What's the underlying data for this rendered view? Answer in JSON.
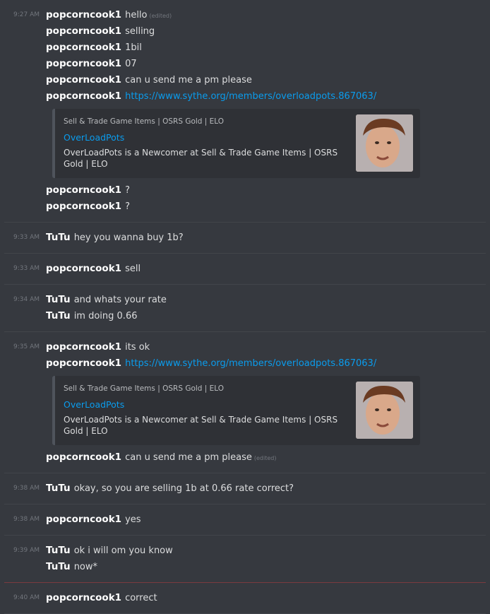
{
  "messages": {
    "g1": {
      "time": "9:27 AM",
      "lines": [
        {
          "author": "popcorncook1",
          "text": "hello",
          "edited": "(edited)"
        },
        {
          "author": "popcorncook1",
          "text": "selling"
        },
        {
          "author": "popcorncook1",
          "text": "1bil"
        },
        {
          "author": "popcorncook1",
          "text": "07"
        },
        {
          "author": "popcorncook1",
          "text": "can u send me a pm please"
        },
        {
          "author": "popcorncook1",
          "link": "https://www.sythe.org/members/overloadpots.867063/"
        }
      ],
      "embed": {
        "provider": "Sell & Trade Game Items | OSRS Gold | ELO",
        "title": "OverLoadPots",
        "description": "OverLoadPots is a Newcomer at Sell & Trade Game Items | OSRS Gold | ELO"
      },
      "after": [
        {
          "author": "popcorncook1",
          "text": "?"
        },
        {
          "author": "popcorncook1",
          "text": "?"
        }
      ]
    },
    "g2": {
      "time": "9:33 AM",
      "author": "TuTu",
      "text": "hey you wanna buy 1b?"
    },
    "g3": {
      "time": "9:33 AM",
      "author": "popcorncook1",
      "text": "sell"
    },
    "g4": {
      "time": "9:34 AM",
      "lines": [
        {
          "author": "TuTu",
          "text": "and whats your rate"
        },
        {
          "author": "TuTu",
          "text": "im doing 0.66"
        }
      ]
    },
    "g5": {
      "time": "9:35 AM",
      "lines": [
        {
          "author": "popcorncook1",
          "text": "its ok"
        },
        {
          "author": "popcorncook1",
          "link": "https://www.sythe.org/members/overloadpots.867063/"
        }
      ],
      "embed": {
        "provider": "Sell & Trade Game Items | OSRS Gold | ELO",
        "title": "OverLoadPots",
        "description": "OverLoadPots is a Newcomer at Sell & Trade Game Items | OSRS Gold | ELO"
      },
      "after": [
        {
          "author": "popcorncook1",
          "text": "can u send me a pm please",
          "edited": "(edited)"
        }
      ]
    },
    "g6": {
      "time": "9:38 AM",
      "author": "TuTu",
      "text": "okay, so you are selling 1b at 0.66 rate correct?"
    },
    "g7": {
      "time": "9:38 AM",
      "author": "popcorncook1",
      "text": "yes"
    },
    "g8": {
      "time": "9:39 AM",
      "lines": [
        {
          "author": "TuTu",
          "text": "ok i will om you know"
        },
        {
          "author": "TuTu",
          "text": "now*"
        }
      ]
    },
    "g9": {
      "time": "9:40 AM",
      "author": "popcorncook1",
      "text": "correct"
    }
  },
  "colors": {
    "background": "#36393f",
    "link": "#0a9ced",
    "embed_bg": "#2f3136",
    "new_message_divider": "#7a3a3f"
  }
}
